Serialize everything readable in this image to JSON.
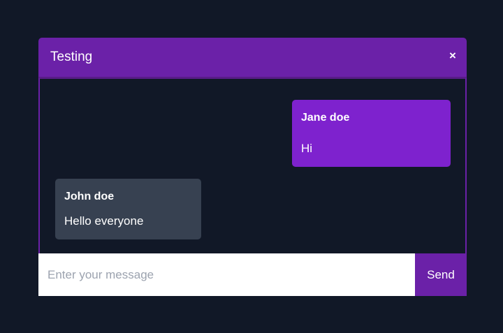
{
  "window": {
    "title": "Testing",
    "close_label": "×"
  },
  "messages": [
    {
      "author": "Jane doe",
      "text": "Hi",
      "side": "right",
      "color": "#7e22ce"
    },
    {
      "author": "John doe",
      "text": "Hello everyone",
      "side": "left",
      "color": "#374151"
    }
  ],
  "composer": {
    "placeholder": "Enter your message",
    "value": "",
    "send_label": "Send"
  },
  "colors": {
    "page_background": "#111827",
    "accent": "#6b21a8",
    "own_message": "#7e22ce",
    "other_message": "#374151"
  }
}
